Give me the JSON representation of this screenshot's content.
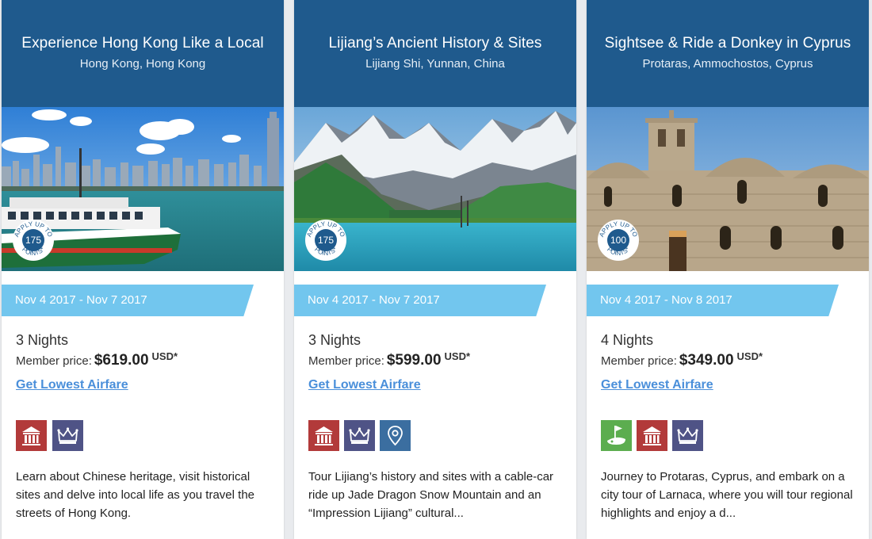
{
  "cards": [
    {
      "title": "Experience Hong Kong Like a Local",
      "location": "Hong Kong, Hong Kong",
      "badge": {
        "line1": "APPLY UP TO",
        "points": "175",
        "line2": "POINTS*"
      },
      "dates": "Nov 4 2017 - Nov 7 2017",
      "nights": "3 Nights",
      "price_label": "Member price:",
      "price": "$619.00",
      "currency": "USD*",
      "airfare_link": "Get Lowest Airfare",
      "icons": [
        "museum-icon",
        "crown-icon"
      ],
      "description": "Learn about Chinese heritage, visit historical sites and delve into local life as you travel the streets of Hong Kong."
    },
    {
      "title": "Lijiang’s Ancient History & Sites",
      "location": "Lijiang Shi, Yunnan, China",
      "badge": {
        "line1": "APPLY UP TO",
        "points": "175",
        "line2": "POINTS*"
      },
      "dates": "Nov 4 2017 - Nov 7 2017",
      "nights": "3 Nights",
      "price_label": "Member price:",
      "price": "$599.00",
      "currency": "USD*",
      "airfare_link": "Get Lowest Airfare",
      "icons": [
        "museum-icon",
        "crown-icon",
        "map-pin-icon"
      ],
      "description": "Tour Lijiang’s history and sites with a cable-car ride up Jade Dragon Snow Mountain and an “Impression Lijiang” cultural..."
    },
    {
      "title": "Sightsee & Ride a Donkey in Cyprus",
      "location": "Protaras, Ammochostos, Cyprus",
      "badge": {
        "line1": "APPLY UP TO",
        "points": "100",
        "line2": "POINTS*"
      },
      "dates": "Nov 4 2017 - Nov 8 2017",
      "nights": "4 Nights",
      "price_label": "Member price:",
      "price": "$349.00",
      "currency": "USD*",
      "airfare_link": "Get Lowest Airfare",
      "icons": [
        "golf-icon",
        "museum-icon",
        "crown-icon"
      ],
      "description": "Journey to Protaras, Cyprus, and embark on a city tour of Larnaca, where you will tour regional highlights and enjoy a d..."
    }
  ],
  "colors": {
    "header": "#1f5a8d",
    "date_band": "#72c6ee",
    "link": "#4a8fda",
    "museum_icon_bg": "#b23a3a",
    "crown_icon_bg": "#4f5386",
    "pin_icon_bg": "#3b6ea0",
    "golf_icon_bg": "#5cad4f"
  }
}
